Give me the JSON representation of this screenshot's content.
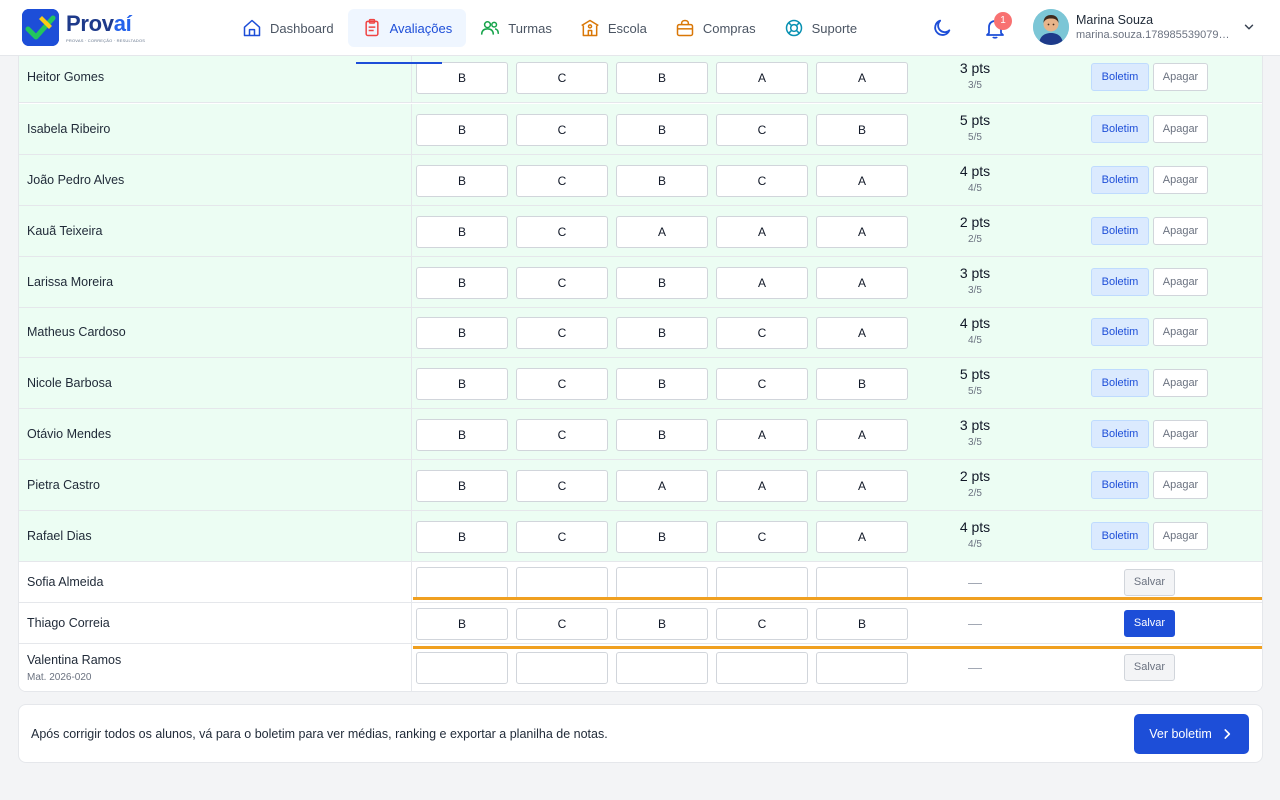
{
  "app": {
    "name_main": "Prov",
    "name_accent": "aí",
    "tagline": "PROVAS · CORREÇÃO · RESULTADOS"
  },
  "nav": [
    {
      "label": "Dashboard",
      "icon": "home-icon"
    },
    {
      "label": "Avaliações",
      "icon": "clipboard-icon",
      "active": true
    },
    {
      "label": "Turmas",
      "icon": "users-icon"
    },
    {
      "label": "Escola",
      "icon": "school-icon"
    },
    {
      "label": "Compras",
      "icon": "shopping-bag-icon"
    },
    {
      "label": "Suporte",
      "icon": "lifebuoy-icon"
    }
  ],
  "notifications": {
    "count": "1"
  },
  "user": {
    "name": "Marina Souza",
    "email": "marina.souza.178985539079…"
  },
  "labels": {
    "boletim": "Boletim",
    "apagar": "Apagar",
    "salvar": "Salvar",
    "dash": "—"
  },
  "students": [
    {
      "name": "Heitor Gomes",
      "answers": [
        "B",
        "C",
        "B",
        "A",
        "A"
      ],
      "pts": "3 pts",
      "frac": "3/5",
      "status": "done"
    },
    {
      "name": "Isabela Ribeiro",
      "answers": [
        "B",
        "C",
        "B",
        "C",
        "B"
      ],
      "pts": "5 pts",
      "frac": "5/5",
      "status": "done"
    },
    {
      "name": "João Pedro Alves",
      "answers": [
        "B",
        "C",
        "B",
        "C",
        "A"
      ],
      "pts": "4 pts",
      "frac": "4/5",
      "status": "done"
    },
    {
      "name": "Kauã Teixeira",
      "answers": [
        "B",
        "C",
        "A",
        "A",
        "A"
      ],
      "pts": "2 pts",
      "frac": "2/5",
      "status": "done"
    },
    {
      "name": "Larissa Moreira",
      "answers": [
        "B",
        "C",
        "B",
        "A",
        "A"
      ],
      "pts": "3 pts",
      "frac": "3/5",
      "status": "done"
    },
    {
      "name": "Matheus Cardoso",
      "answers": [
        "B",
        "C",
        "B",
        "C",
        "A"
      ],
      "pts": "4 pts",
      "frac": "4/5",
      "status": "done"
    },
    {
      "name": "Nicole Barbosa",
      "answers": [
        "B",
        "C",
        "B",
        "C",
        "B"
      ],
      "pts": "5 pts",
      "frac": "5/5",
      "status": "done"
    },
    {
      "name": "Otávio Mendes",
      "answers": [
        "B",
        "C",
        "B",
        "A",
        "A"
      ],
      "pts": "3 pts",
      "frac": "3/5",
      "status": "done"
    },
    {
      "name": "Pietra Castro",
      "answers": [
        "B",
        "C",
        "A",
        "A",
        "A"
      ],
      "pts": "2 pts",
      "frac": "2/5",
      "status": "done"
    },
    {
      "name": "Rafael Dias",
      "answers": [
        "B",
        "C",
        "B",
        "C",
        "A"
      ],
      "pts": "4 pts",
      "frac": "4/5",
      "status": "done"
    },
    {
      "name": "Sofia Almeida",
      "answers": [
        "",
        "",
        "",
        "",
        ""
      ],
      "status": "empty"
    },
    {
      "name": "Thiago Correia",
      "answers": [
        "B",
        "C",
        "B",
        "C",
        "B"
      ],
      "status": "filled"
    },
    {
      "name": "Valentina Ramos",
      "mat": "Mat. 2026-020",
      "answers": [
        "",
        "",
        "",
        "",
        ""
      ],
      "status": "empty"
    }
  ],
  "footer": {
    "text": "Após corrigir todos os alunos, vá para o boletim para ver médias, ranking e exportar a planilha de notas.",
    "button": "Ver boletim"
  },
  "colors": {
    "primary": "#1d4ed8",
    "done_row": "#ecfdf3",
    "highlight": "#f0a020",
    "badge": "#f87171"
  }
}
